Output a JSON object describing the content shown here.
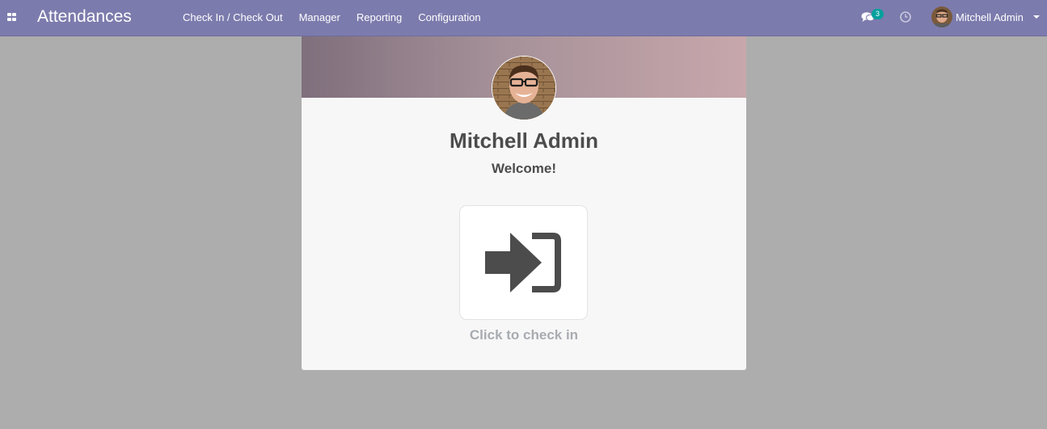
{
  "navbar": {
    "app_title": "Attendances",
    "menu": [
      {
        "label": "Check In / Check Out"
      },
      {
        "label": "Manager"
      },
      {
        "label": "Reporting"
      },
      {
        "label": "Configuration"
      }
    ],
    "messages_count": "3",
    "user_name": "Mitchell Admin",
    "icons": [
      "apps-icon",
      "chat-icon",
      "clock-icon",
      "caret-down-icon"
    ],
    "colors": {
      "navbar": "#7c7bad",
      "badge": "#00a09d"
    }
  },
  "kiosk": {
    "employee_name": "Mitchell Admin",
    "greeting": "Welcome!",
    "action_label": "Click to check in",
    "action_icon": "sign-in-icon"
  }
}
